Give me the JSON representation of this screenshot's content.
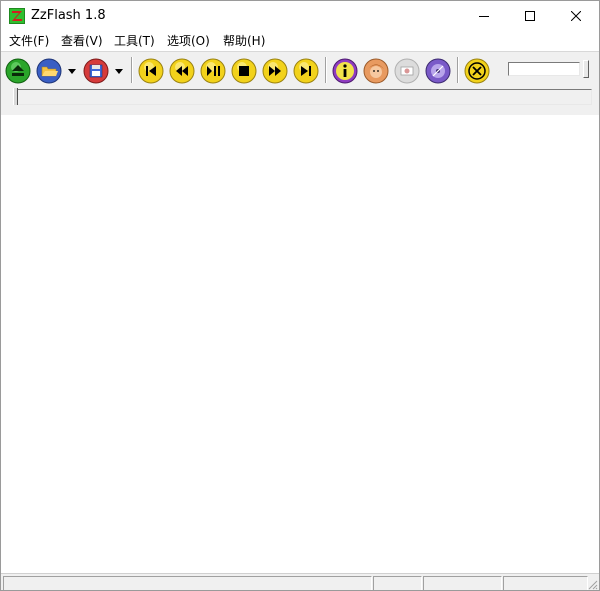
{
  "window": {
    "title": "ZzFlash 1.8",
    "app_icon": "zzflash-app-icon",
    "controls": [
      "minimize-icon",
      "maximize-icon",
      "close-icon"
    ]
  },
  "menu": {
    "items": [
      {
        "label": "文件(F)"
      },
      {
        "label": "查看(V)"
      },
      {
        "label": "工具(T)"
      },
      {
        "label": "选项(O)"
      },
      {
        "label": "帮助(H)"
      }
    ]
  },
  "toolbar": {
    "buttons": [
      {
        "icon": "eject-icon",
        "color": "#2aa52a"
      },
      {
        "icon": "open-folder-icon",
        "color": "#3a5fc4"
      },
      {
        "icon": "save-icon",
        "color": "#5b7fd6"
      },
      {
        "icon": "skip-back-icon",
        "color": "#f2d21b"
      },
      {
        "icon": "rewind-icon",
        "color": "#f2d21b"
      },
      {
        "icon": "play-pause-icon",
        "color": "#f2d21b"
      },
      {
        "icon": "stop-icon",
        "color": "#f2d21b"
      },
      {
        "icon": "fast-forward-icon",
        "color": "#f2d21b"
      },
      {
        "icon": "skip-forward-icon",
        "color": "#f2d21b"
      },
      {
        "icon": "info-icon",
        "color": "#8e3cc0"
      },
      {
        "icon": "face-icon",
        "color": "#e89a60"
      },
      {
        "icon": "capture-icon",
        "color": "#c9c9c9"
      },
      {
        "icon": "settings-disc-icon",
        "color": "#7a5ac8"
      },
      {
        "icon": "help-tool-icon",
        "color": "#f2d21b"
      }
    ],
    "volume_value": "",
    "playback_progress": 0
  },
  "statusbar": {
    "panes": [
      "",
      "",
      "",
      ""
    ]
  },
  "colors": {
    "toolbar_bg": "#f0f0f0",
    "content_bg": "#ffffff"
  }
}
